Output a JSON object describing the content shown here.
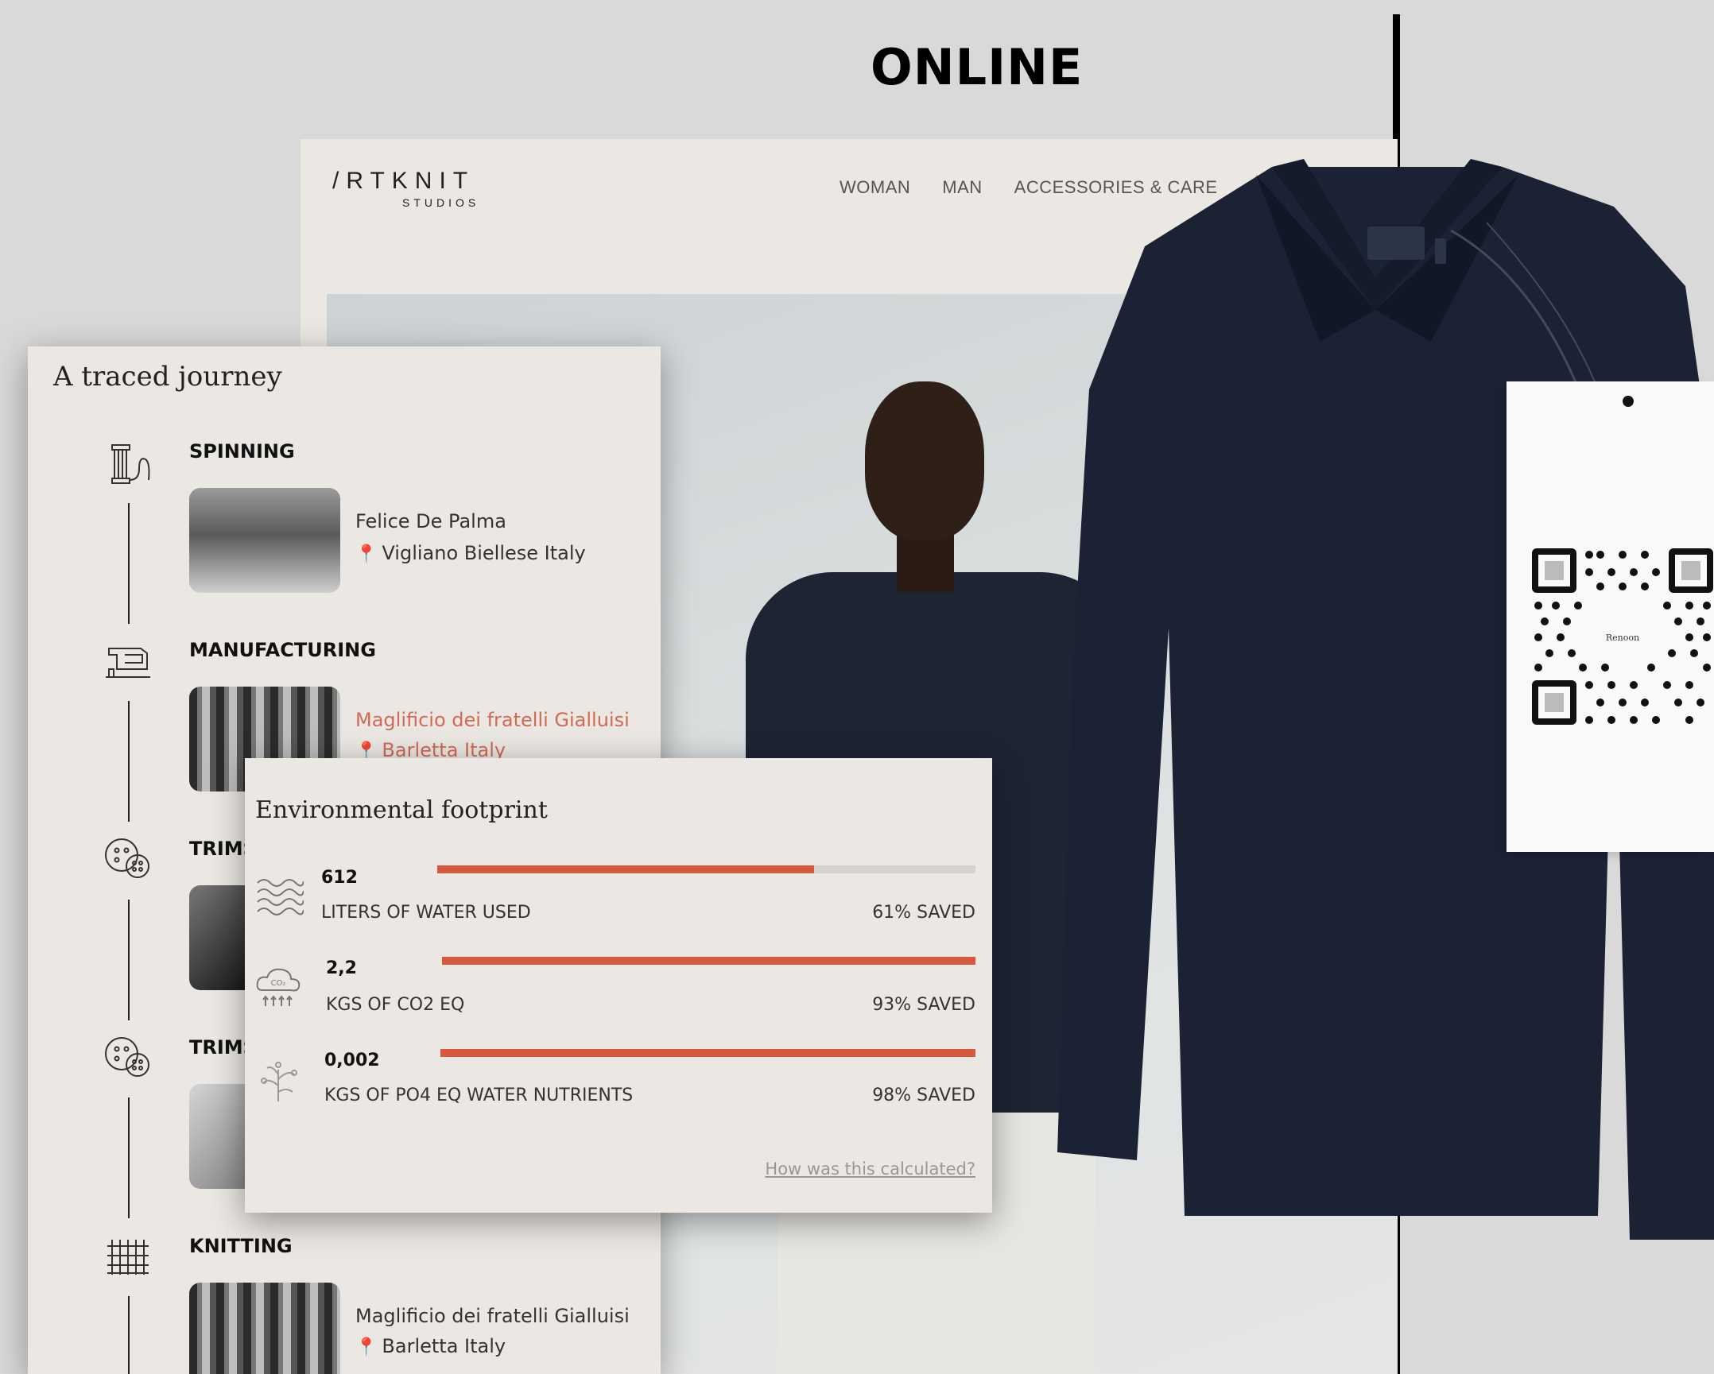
{
  "heading": "ONLINE",
  "site": {
    "logo_main": "/RTKNIT",
    "logo_sub": "STUDIOS",
    "nav": [
      "WOMAN",
      "MAN",
      "ACCESSORIES & CARE"
    ]
  },
  "journey": {
    "title": "A traced journey",
    "stages": [
      {
        "label": "SPINNING",
        "icon": "spool-icon",
        "supplier": "Felice De Palma",
        "location": "Vigliano Biellese Italy"
      },
      {
        "label": "MANUFACTURING",
        "icon": "sewing-machine-icon",
        "supplier": "Maglificio dei fratelli Gialluisi",
        "location": "Barletta Italy"
      },
      {
        "label": "TRIMS",
        "icon": "buttons-icon"
      },
      {
        "label": "TRIMS",
        "icon": "buttons-icon"
      },
      {
        "label": "KNITTING",
        "icon": "knit-grid-icon",
        "supplier": "Maglificio dei fratelli Gialluisi",
        "location": "Barletta Italy"
      }
    ]
  },
  "footprint": {
    "title": "Environmental footprint",
    "accent_color": "#d6593f",
    "metrics": [
      {
        "value": "612",
        "label": "LITERS OF WATER USED",
        "saved": "61% SAVED",
        "icon": "water-waves-icon",
        "fill_fraction": 0.7
      },
      {
        "value": "2,2",
        "label": "KGS OF CO2 EQ",
        "saved": "93% SAVED",
        "icon": "co2-cloud-icon",
        "co2_text": "CO₂",
        "fill_fraction": 1.0
      },
      {
        "value": "0,002",
        "label": "KGS OF PO4 EQ WATER NUTRIENTS",
        "saved": "98% SAVED",
        "icon": "plant-icon",
        "fill_fraction": 1.0
      }
    ],
    "calc_link": "How was this calculated?"
  },
  "tag": {
    "qr_text": "Renoon"
  }
}
